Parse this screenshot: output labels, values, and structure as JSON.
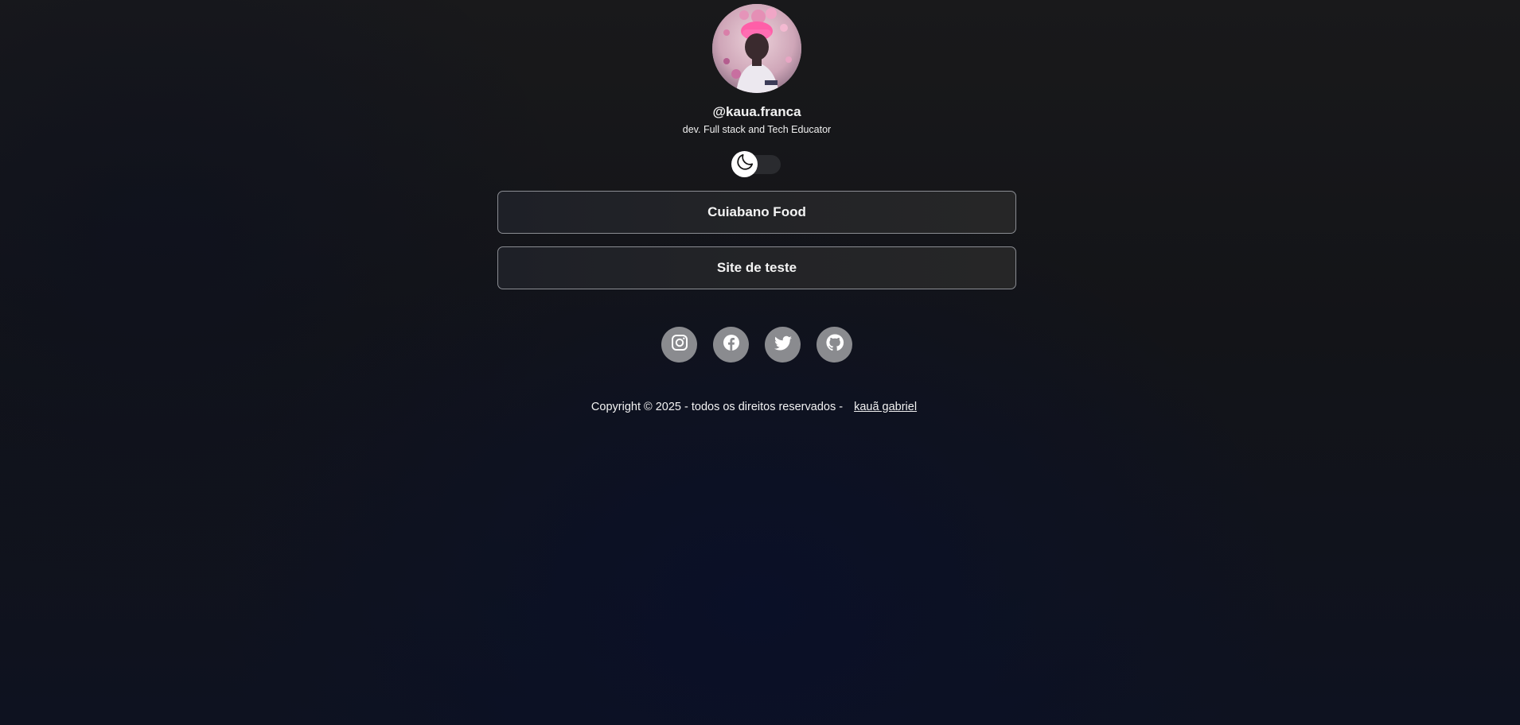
{
  "profile": {
    "username": "@kaua.franca",
    "bio": "dev. Full stack and Tech Educator"
  },
  "theme_toggle": {
    "icon": "moon-icon",
    "state": "dark"
  },
  "links": [
    {
      "label": "Cuiabano Food"
    },
    {
      "label": "Site de teste"
    }
  ],
  "socials": [
    {
      "icon": "instagram-icon"
    },
    {
      "icon": "facebook-icon"
    },
    {
      "icon": "twitter-icon"
    },
    {
      "icon": "github-icon"
    }
  ],
  "footer": {
    "copyright": "Copyright © 2025 - todos os direitos reservados -",
    "author_link": "kauã gabriel"
  },
  "colors": {
    "background": "#131418",
    "button_border": "#8b8d93",
    "social_bg": "#8a8b8f",
    "text": "#f2f2f2"
  }
}
